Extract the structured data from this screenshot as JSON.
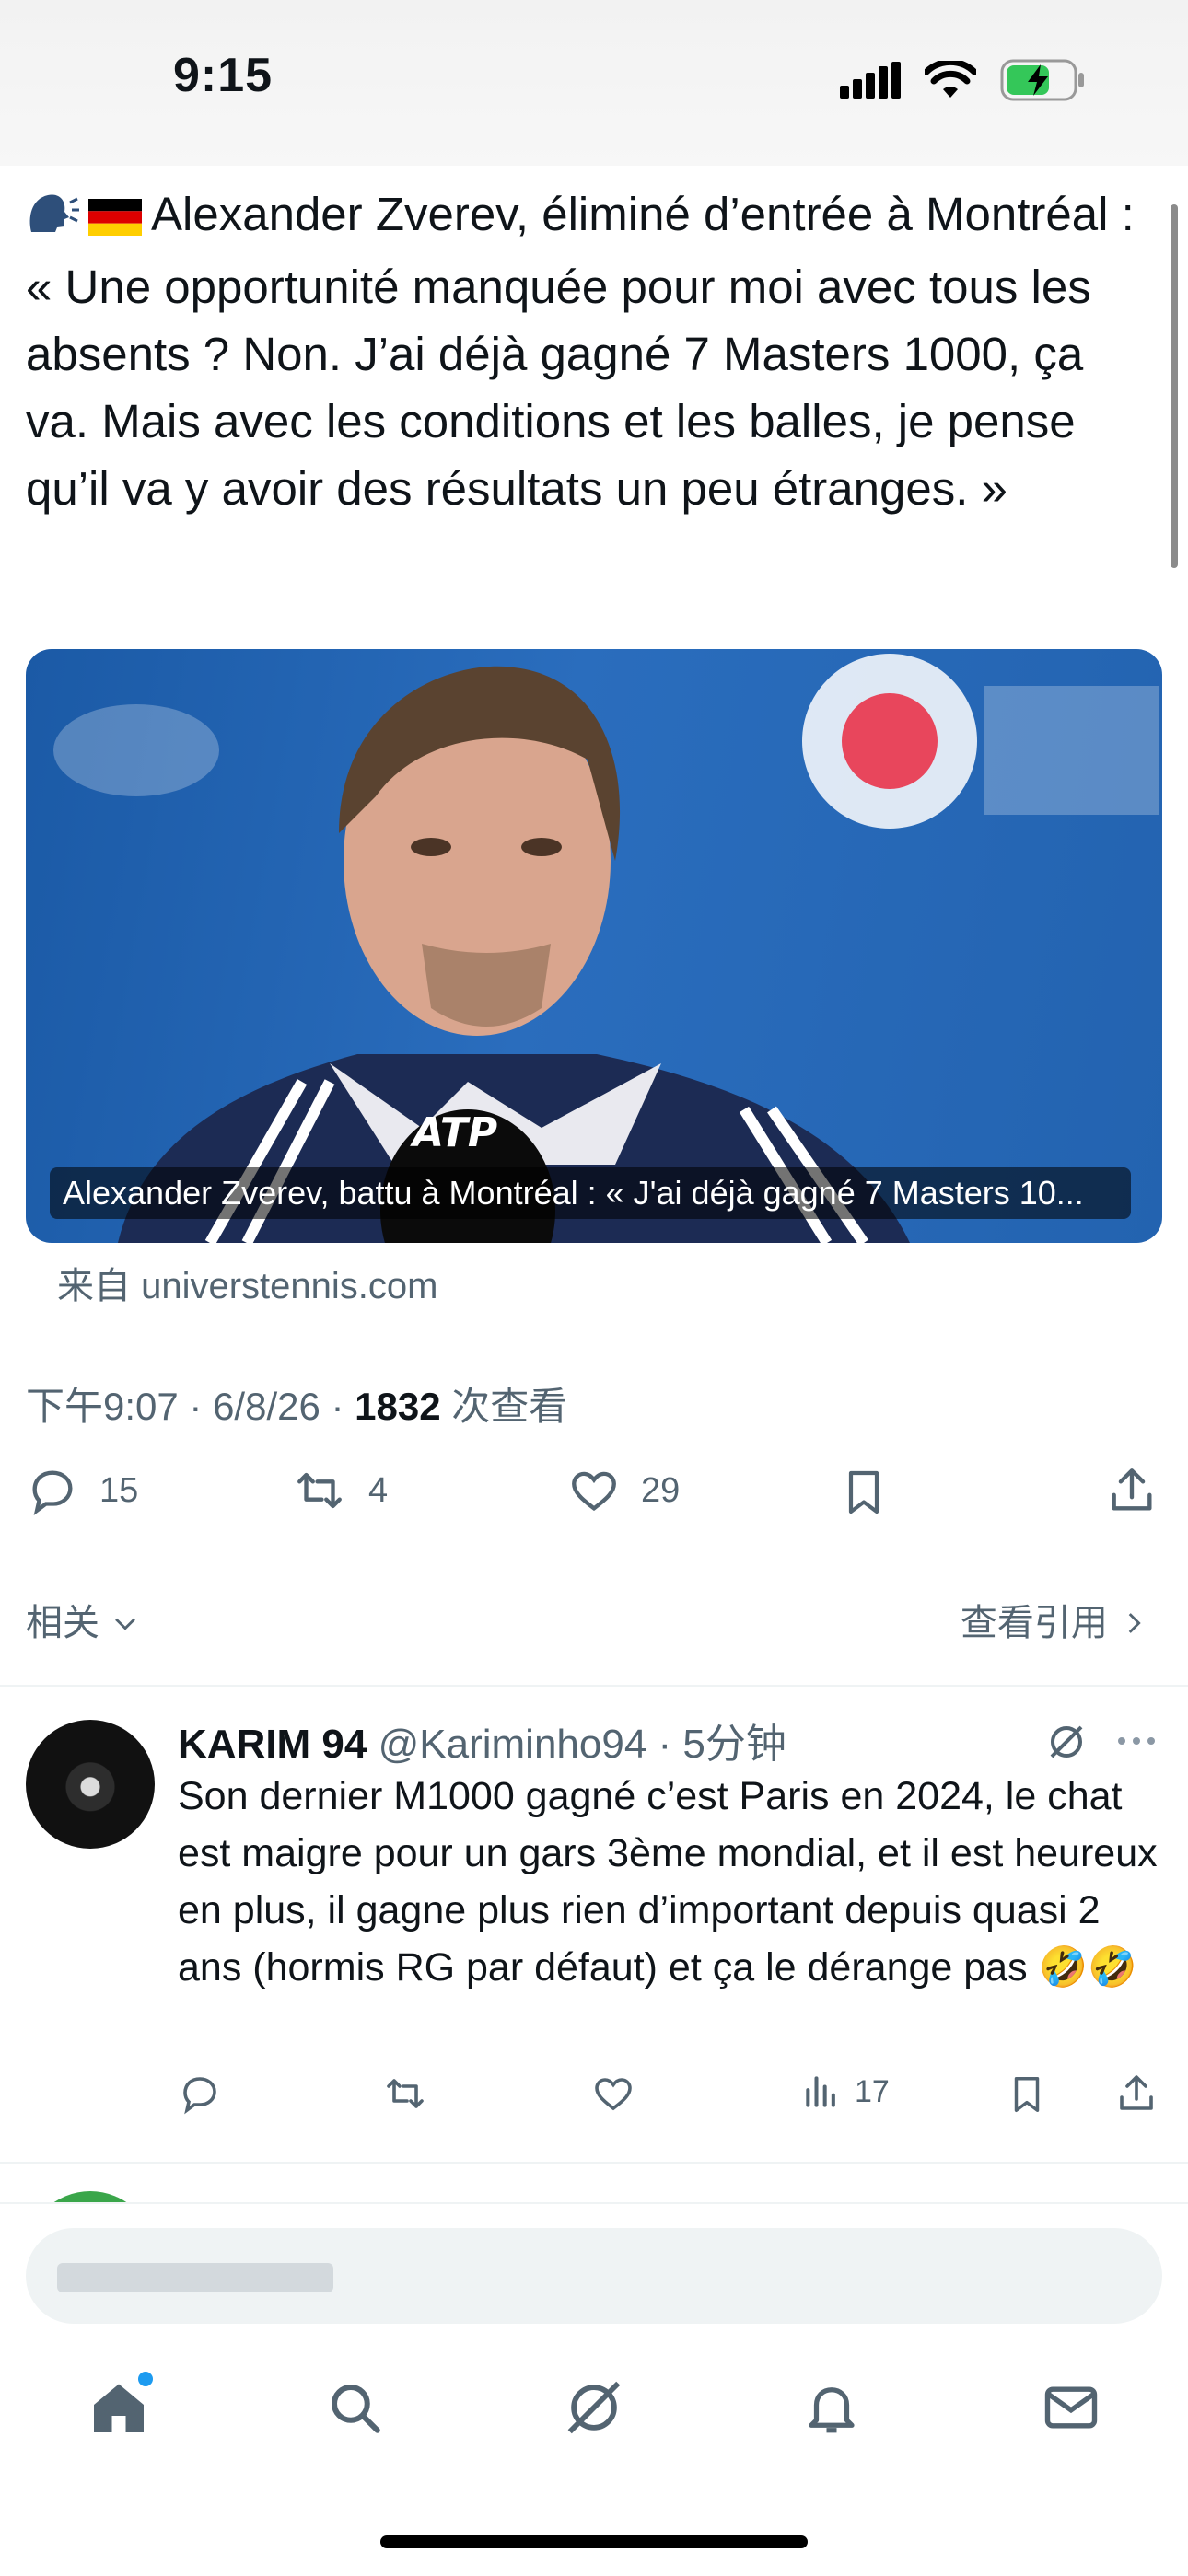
{
  "status_bar": {
    "time": "9:15"
  },
  "tweet": {
    "text": "Alexander Zverev, éliminé d’entrée à Montréal : « Une opportunité manquée pour moi avec tous les absents ? Non. J’ai déjà gagné 7 Masters 1000, ça va. Mais avec les conditions et les balles, je pense qu’il va y avoir des résultats un peu étranges. »",
    "card_caption": "Alexander Zverev, battu à Montréal : « J'ai déjà gagné 7 Masters 10...",
    "source": "来自 universtennis.com",
    "meta_time": "下午9:07 · 6/8/26 · ",
    "views_count": "1832",
    "views_label": " 次查看",
    "replies": "15",
    "retweets": "4",
    "likes": "29",
    "related_label": "相关",
    "quotes_label": "查看引用"
  },
  "reply": {
    "name": "KARIM 94",
    "handle": "@Kariminho94 · 5分钟",
    "text": "Son dernier M1000 gagné c’est Paris en 2024, le chat est maigre pour un gars 3ème mondial, et il est heureux en plus, il gagne plus rien d’important depuis quasi 2 ans (hormis RG par défaut) et ça le dérange pas 🤣🤣",
    "views": "17"
  },
  "colors": {
    "text": "#0f1419",
    "secondary": "#536471",
    "divider": "#eff3f4",
    "notification_dot": "#1d9bf0"
  },
  "icons": [
    "speaking-head-icon",
    "germany-flag-icon",
    "comment-icon",
    "retweet-icon",
    "heart-icon",
    "bookmark-icon",
    "share-icon",
    "views-icon",
    "grok-icon",
    "more-icon",
    "home-icon",
    "search-icon",
    "notifications-icon",
    "messages-icon"
  ]
}
